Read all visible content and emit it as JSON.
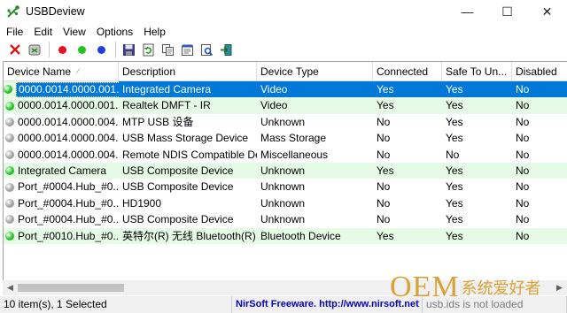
{
  "window": {
    "title": "USBDeview",
    "controls": {
      "minimize": "—",
      "maximize": "☐",
      "close": "✕"
    }
  },
  "menu": [
    "File",
    "Edit",
    "View",
    "Options",
    "Help"
  ],
  "toolbar": {
    "icons": [
      "delete-icon",
      "uninstall-icon",
      "red-dot-icon",
      "green-dot-icon",
      "blue-dot-icon",
      "save-icon",
      "refresh-icon",
      "copy-icon",
      "properties-icon",
      "find-icon",
      "exit-icon"
    ],
    "colors": {
      "red": "#e81123",
      "green": "#21c321",
      "blue": "#1f3fd8"
    }
  },
  "columns": [
    "Device Name",
    "Description",
    "Device Type",
    "Connected",
    "Safe To Un...",
    "Disabled"
  ],
  "rows": [
    {
      "status": "green",
      "name": "0000.0014.0000.001...",
      "description": "Integrated Camera",
      "type": "Video",
      "connected": "Yes",
      "safe": "Yes",
      "disabled": "No",
      "selected": true
    },
    {
      "status": "green",
      "name": "0000.0014.0000.001...",
      "description": "Realtek DMFT - IR",
      "type": "Video",
      "connected": "Yes",
      "safe": "Yes",
      "disabled": "No"
    },
    {
      "status": "gray",
      "name": "0000.0014.0000.004...",
      "description": "MTP USB 设备",
      "type": "Unknown",
      "connected": "No",
      "safe": "Yes",
      "disabled": "No"
    },
    {
      "status": "gray",
      "name": "0000.0014.0000.004...",
      "description": "USB Mass Storage Device",
      "type": "Mass Storage",
      "connected": "No",
      "safe": "Yes",
      "disabled": "No"
    },
    {
      "status": "gray",
      "name": "0000.0014.0000.004...",
      "description": "Remote NDIS Compatible Device",
      "type": "Miscellaneous",
      "connected": "No",
      "safe": "No",
      "disabled": "No"
    },
    {
      "status": "green",
      "name": "Integrated Camera",
      "description": "USB Composite Device",
      "type": "Unknown",
      "connected": "Yes",
      "safe": "Yes",
      "disabled": "No"
    },
    {
      "status": "gray",
      "name": "Port_#0004.Hub_#0...",
      "description": "USB Composite Device",
      "type": "Unknown",
      "connected": "No",
      "safe": "Yes",
      "disabled": "No"
    },
    {
      "status": "gray",
      "name": "Port_#0004.Hub_#0...",
      "description": "HD1900",
      "type": "Unknown",
      "connected": "No",
      "safe": "Yes",
      "disabled": "No"
    },
    {
      "status": "gray",
      "name": "Port_#0004.Hub_#0...",
      "description": "USB Composite Device",
      "type": "Unknown",
      "connected": "No",
      "safe": "Yes",
      "disabled": "No"
    },
    {
      "status": "green",
      "name": "Port_#0010.Hub_#0...",
      "description": "英特尔(R) 无线 Bluetooth(R)",
      "type": "Bluetooth Device",
      "connected": "Yes",
      "safe": "Yes",
      "disabled": "No"
    }
  ],
  "statusbar": {
    "count": "10 item(s), 1 Selected",
    "nirsoft": "NirSoft Freeware.  http://www.nirsoft.net",
    "usbids": "usb.ids is not loaded"
  },
  "watermark": {
    "logo": "OEM",
    "text": "系统爱好者"
  },
  "colors": {
    "selection": "#0078d7",
    "connected_row": "#e6fbe6",
    "status_green": "#22c322",
    "status_gray": "#a0a0a0",
    "watermark": "#d9a237"
  }
}
